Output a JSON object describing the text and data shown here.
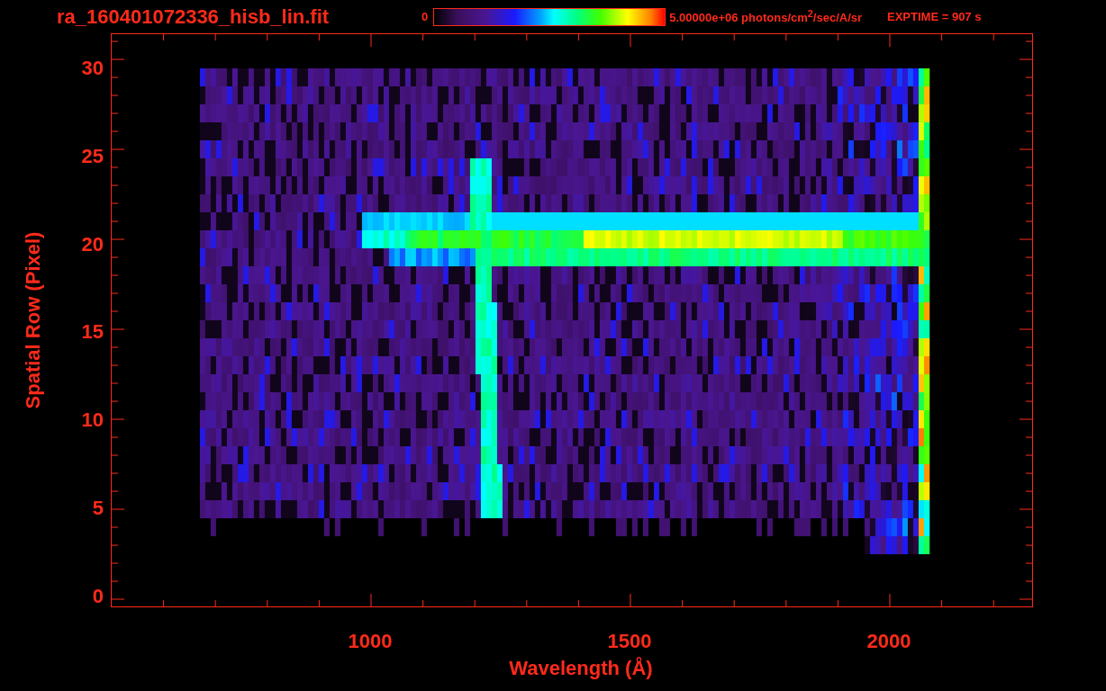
{
  "header": {
    "filename": "ra_160401072336_hisb_lin.fit",
    "colorbar": {
      "min_label": "0",
      "max_label": "5.00000e+06 photons/cm$^{2}$/sec/A/sr"
    },
    "exposure": "EXPTIME = 907 s"
  },
  "plot": {
    "y_axis": {
      "label": "Spatial Row (Pixel)",
      "ticks": [
        "30",
        "25",
        "20",
        "15",
        "10",
        "5",
        "0"
      ]
    },
    "x_axis": {
      "label": "Wavelength (Å)",
      "ticks": [
        "1000",
        "1500",
        "2000"
      ]
    }
  }
}
